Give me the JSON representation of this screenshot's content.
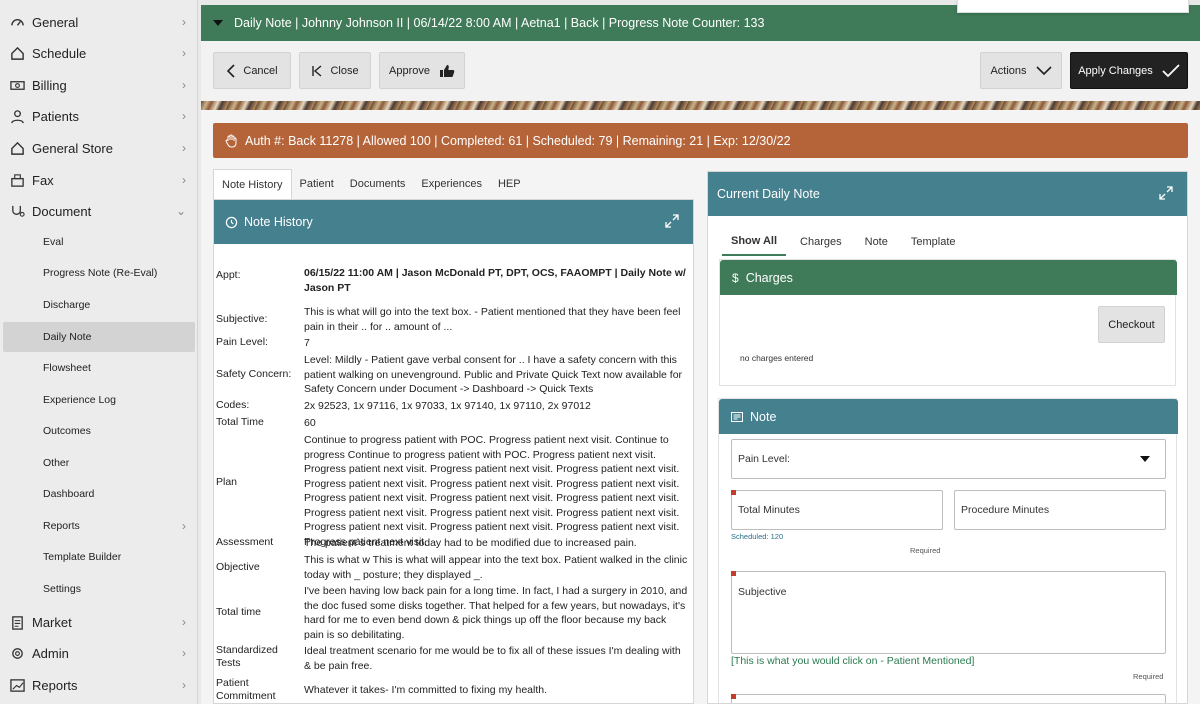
{
  "sidebar": {
    "items": [
      {
        "label": "General",
        "icon": "gauge-icon"
      },
      {
        "label": "Schedule",
        "icon": "home-icon"
      },
      {
        "label": "Billing",
        "icon": "money-icon"
      },
      {
        "label": "Patients",
        "icon": "user-icon"
      },
      {
        "label": "General Store",
        "icon": "home-icon"
      },
      {
        "label": "Fax",
        "icon": "fax-icon"
      },
      {
        "label": "Document",
        "icon": "stethoscope-icon"
      }
    ],
    "document_sub": [
      "Eval",
      "Progress Note (Re-Eval)",
      "Discharge",
      "Daily Note",
      "Flowsheet",
      "Experience Log",
      "Outcomes",
      "Other",
      "Dashboard",
      "Reports",
      "Template Builder",
      "Settings"
    ],
    "items_bottom": [
      {
        "label": "Market",
        "icon": "clipboard-icon"
      },
      {
        "label": "Admin",
        "icon": "gear-icon"
      },
      {
        "label": "Reports",
        "icon": "chart-icon"
      }
    ]
  },
  "header": {
    "title": "Daily Note | Johnny Johnson II | 06/14/22 8:00 AM | Aetna1 | Back | Progress Note Counter: 133"
  },
  "toolbar": {
    "cancel": "Cancel",
    "close": "Close",
    "approve": "Approve",
    "actions": "Actions",
    "apply": "Apply Changes"
  },
  "auth": {
    "text": "Auth #: Back 11278 | Allowed 100 | Completed: 61 | Scheduled: 79 | Remaining: 21 | Exp: 12/30/22"
  },
  "left_tabs": [
    "Note History",
    "Patient",
    "Documents",
    "Experiences",
    "HEP"
  ],
  "note_history": {
    "title": "Note History",
    "rows": [
      {
        "label": "Appt:",
        "value": "06/15/22 11:00 AM | Jason McDonald PT, DPT, OCS, FAAOMPT | Daily Note w/ Jason PT"
      },
      {
        "label": "Subjective:",
        "value": "This is what will go into the text box. - Patient mentioned that they have been feel pain in their .. for .. amount of ..."
      },
      {
        "label": "Pain Level:",
        "value": "7"
      },
      {
        "label": "Safety Concern:",
        "value": "Level: Mildly - Patient gave verbal consent for .. I have a safety concern with this patient walking on unevenground. Public and Private Quick Text now available for Safety Concern under Document -> Dashboard -> Quick Texts"
      },
      {
        "label": "Codes:",
        "value": "2x 92523, 1x 97116, 1x 97033, 1x 97140, 1x 97110, 2x 97012"
      },
      {
        "label": "Total Time",
        "value": "60"
      },
      {
        "label": "Plan",
        "value": "Continue to progress patient with POC. Progress patient next visit. Continue to progress Continue to progress patient with POC. Progress patient next visit. Progress patient next visit. Progress patient next visit. Progress patient next visit. Progress patient next visit. Progress patient next visit. Progress patient next visit. Progress patient next visit. Progress patient next visit. Progress patient next visit. Progress patient next visit. Progress patient next visit. Progress patient next visit. Progress patient next visit. Progress patient next visit. Progress patient next visit. Progress patient next visit."
      },
      {
        "label": "Assessment",
        "value": "The patient`s treatment today had to be modified due to increased pain."
      },
      {
        "label": "Objective",
        "value": " This is what w  This is what will appear into the text box. Patient walked in the clinic today with _ posture; they displayed _."
      },
      {
        "label": "Total time",
        "value": "I've been having low back pain for a long time. In fact, I had a surgery in 2010, and the doc fused some disks together. That helped for a few years, but nowadays, it's hard for me to even bend down & pick things up off the floor because my back pain is so debilitating."
      },
      {
        "label": "Standardized Tests",
        "value": "Ideal treatment scenario for me would be to fix all of these issues I'm dealing with & be pain free."
      },
      {
        "label": "Patient Commitment",
        "value": "Whatever it takes- I'm committed to fixing my health."
      }
    ]
  },
  "current_note": {
    "title": "Current Daily Note",
    "tabs": [
      "Show All",
      "Charges",
      "Note",
      "Template"
    ],
    "charges": {
      "title": "Charges",
      "icon": "dollar-icon",
      "checkout": "Checkout",
      "empty": "no charges entered"
    },
    "note": {
      "title": "Note",
      "pain_level_label": "Pain Level:",
      "total_minutes_label": "Total Minutes",
      "scheduled": "Scheduled: 120",
      "procedure_minutes_label": "Procedure Minutes",
      "required": "Required",
      "subjective_label": "Subjective",
      "subjective_link": "[This is what you would click on - Patient Mentioned]"
    }
  },
  "colors": {
    "header_green": "#3f7a59",
    "teal": "#45808f",
    "auth_orange": "#b5643a",
    "required_red": "#c43c2a"
  }
}
